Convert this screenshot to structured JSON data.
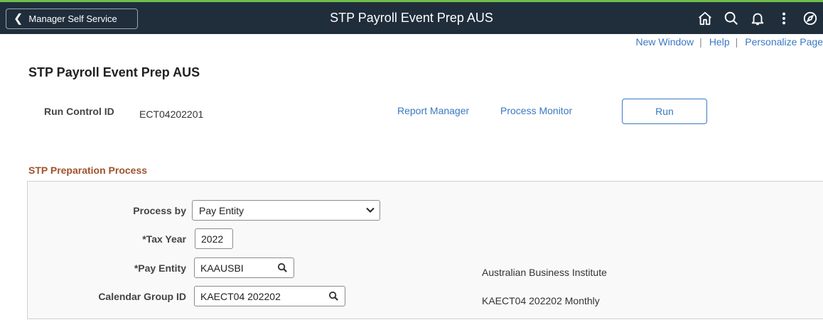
{
  "header": {
    "back_label": "Manager Self Service",
    "title": "STP Payroll Event Prep AUS",
    "icons": [
      "home-icon",
      "search-icon",
      "bell-icon",
      "kebab-menu-icon",
      "compass-icon"
    ],
    "colors": {
      "bar": "#202e3c",
      "accent_strip": "#6fbf4a"
    }
  },
  "page_links": {
    "new_window": "New Window",
    "help": "Help",
    "personalize": "Personalize Page",
    "separator": "|"
  },
  "page": {
    "title": "STP Payroll Event Prep AUS",
    "run_control_label": "Run Control ID",
    "run_control_value": "ECT04202201",
    "report_manager": "Report Manager",
    "process_monitor": "Process Monitor",
    "run_label": "Run"
  },
  "section": {
    "title": "STP Preparation Process",
    "title_color": "#a0522d",
    "fields": {
      "process_by_label": "Process by",
      "process_by_value": "Pay Entity",
      "tax_year_label": "*Tax Year",
      "tax_year_value": "2022",
      "pay_entity_label": "*Pay Entity",
      "pay_entity_value": "KAAUSBI",
      "pay_entity_desc": "Australian Business Institute",
      "calendar_group_label": "Calendar Group ID",
      "calendar_group_value": "KAECT04 202202",
      "calendar_group_desc": "KAECT04 202202 Monthly"
    }
  }
}
